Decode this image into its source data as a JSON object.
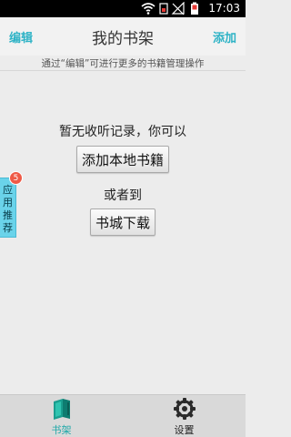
{
  "status_bar": {
    "time": "17:03"
  },
  "header": {
    "edit_label": "编辑",
    "title": "我的书架",
    "add_label": "添加"
  },
  "hint": "通过“编辑”可进行更多的书籍管理操作",
  "empty_state": {
    "message": "暂无收听记录，你可以",
    "add_local_label": "添加本地书籍",
    "or_label": "或者到",
    "store_label": "书城下载"
  },
  "side_tab": {
    "label_line1": "应用",
    "label_line2": "推荐",
    "badge_count": "5"
  },
  "bottom_nav": {
    "items": [
      {
        "label": "书架",
        "icon": "books-icon",
        "active": true
      },
      {
        "label": "设置",
        "icon": "gear-icon",
        "active": false
      }
    ]
  },
  "colors": {
    "accent": "#2fb3c6",
    "side_tab": "#6ad3ea",
    "badge": "#ef5a46"
  }
}
